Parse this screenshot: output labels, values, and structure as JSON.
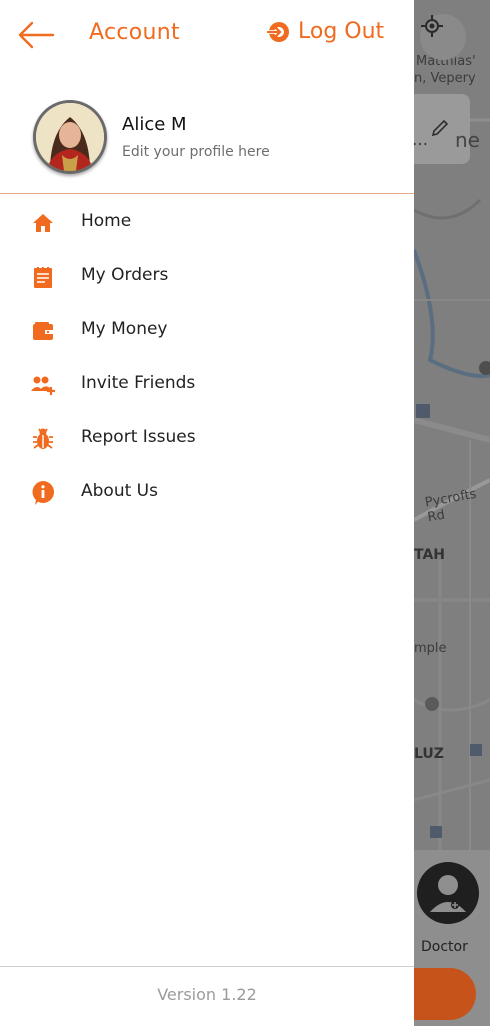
{
  "header": {
    "title": "Account",
    "logout_label": "Log Out"
  },
  "profile": {
    "name": "Alice M",
    "subtitle": "Edit your profile here"
  },
  "menu": [
    {
      "label": "Home",
      "icon": "home-icon"
    },
    {
      "label": "My Orders",
      "icon": "orders-icon"
    },
    {
      "label": "My Money",
      "icon": "wallet-icon"
    },
    {
      "label": "Invite Friends",
      "icon": "invite-friends-icon"
    },
    {
      "label": "Report Issues",
      "icon": "bug-icon"
    },
    {
      "label": "About Us",
      "icon": "info-icon"
    }
  ],
  "footer": {
    "version": "Version 1.22"
  },
  "map": {
    "labels": [
      "Matthias'",
      "n, Vepery",
      "Pycrofts Rd",
      "TAH",
      "mple",
      "LUZ"
    ],
    "card_fragment": "ne",
    "doctor_label": "Doctor"
  },
  "colors": {
    "accent": "#f06b1f",
    "divider": "#e6a98a"
  }
}
